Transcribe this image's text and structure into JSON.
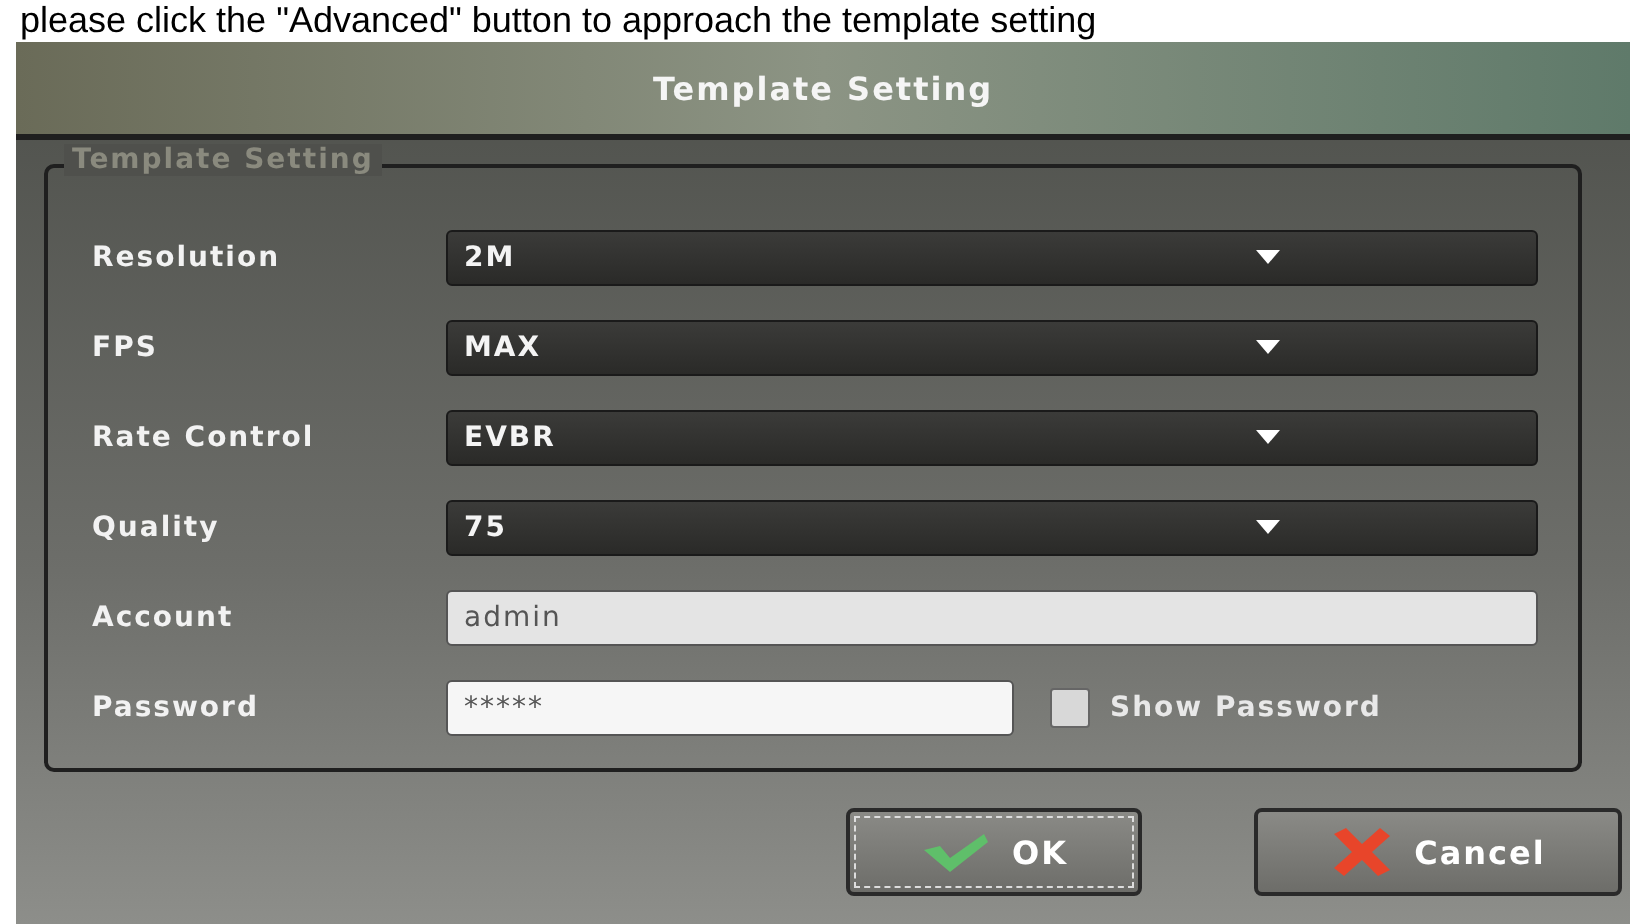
{
  "caption": "please click the \"Advanced\" button to approach the template setting",
  "window": {
    "title": "Template Setting"
  },
  "group": {
    "title": "Template Setting"
  },
  "fields": [
    {
      "label": "Resolution",
      "kind": "dropdown",
      "value": "2M"
    },
    {
      "label": "FPS",
      "kind": "dropdown",
      "value": "MAX"
    },
    {
      "label": "Rate Control",
      "kind": "dropdown",
      "value": "EVBR"
    },
    {
      "label": "Quality",
      "kind": "dropdown",
      "value": "75"
    },
    {
      "label": "Account",
      "kind": "text",
      "value": "admin"
    },
    {
      "label": "Password",
      "kind": "password",
      "value": "*****"
    }
  ],
  "show_password": {
    "label": "Show Password",
    "checked": false
  },
  "buttons": [
    {
      "label": "OK",
      "kind": "ok",
      "focused": true
    },
    {
      "label": "Cancel",
      "kind": "cancel",
      "focused": false
    }
  ]
}
